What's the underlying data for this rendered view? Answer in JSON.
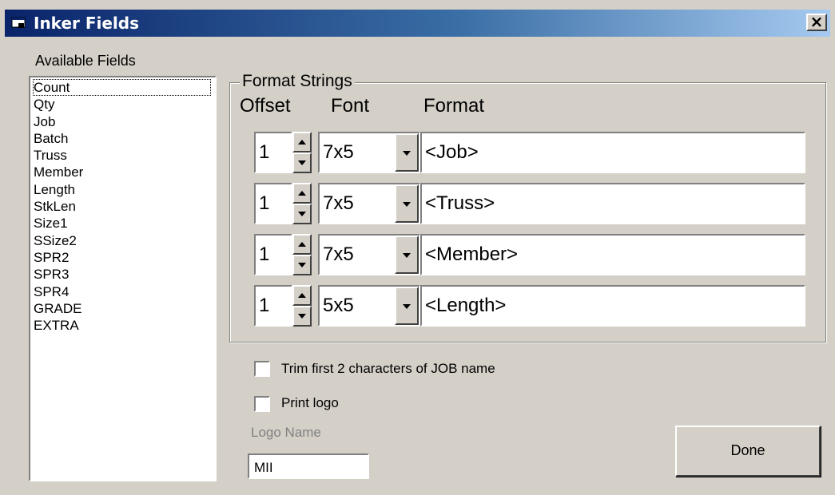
{
  "window": {
    "title": "Inker Fields",
    "close_label": "×"
  },
  "available_fields": {
    "label": "Available Fields",
    "items": [
      "Count",
      "Qty",
      "Job",
      "Batch",
      "Truss",
      "Member",
      "Length",
      "StkLen",
      "Size1",
      "SSize2",
      "SPR2",
      "SPR3",
      "SPR4",
      "GRADE",
      "EXTRA"
    ],
    "selected": "Count"
  },
  "format_strings": {
    "group_label": "Format Strings",
    "headers": {
      "offset": "Offset",
      "font": "Font",
      "format": "Format"
    },
    "rows": [
      {
        "offset": "1",
        "font": "7x5",
        "format": "<Job>"
      },
      {
        "offset": "1",
        "font": "7x5",
        "format": "<Truss>"
      },
      {
        "offset": "1",
        "font": "7x5",
        "format": "<Member>"
      },
      {
        "offset": "1",
        "font": "5x5",
        "format": "<Length>"
      }
    ]
  },
  "options": {
    "trim_label": "Trim first 2 characters of JOB name",
    "trim_checked": false,
    "print_logo_label": "Print logo",
    "print_logo_checked": false,
    "logo_name_label": "Logo Name",
    "logo_name_value": "MII"
  },
  "buttons": {
    "done": "Done"
  }
}
